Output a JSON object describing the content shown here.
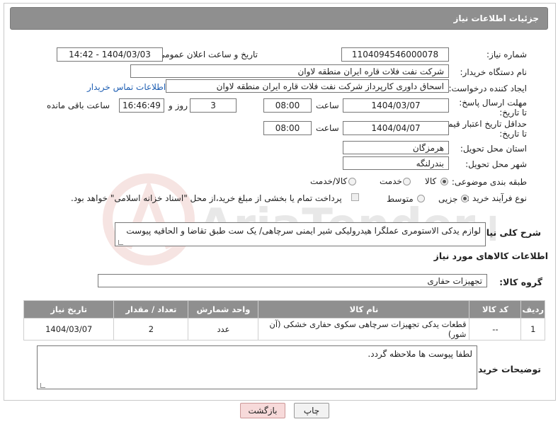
{
  "page_title": "جزئیات اطلاعات نیاز",
  "fields": {
    "need_number_label": "شماره نیاز:",
    "need_number": "1104094546000078",
    "announce_label": "تاریخ و ساعت اعلان عمومی:",
    "announce_value": "1404/03/03 - 14:42",
    "buyer_org_label": "نام دستگاه خریدار:",
    "buyer_org": "شرکت نفت فلات قاره ایران منطقه لاوان",
    "requester_label": "ایجاد کننده درخواست:",
    "requester": "اسحاق داوری کارپرداز شرکت نفت فلات قاره ایران منطقه لاوان",
    "buyer_contact_link": "اطلاعات تماس خریدار",
    "deadline_label": "مهلت ارسال پاسخ: تا تاریخ:",
    "deadline_date": "1404/03/07",
    "time_label": "ساعت",
    "deadline_time": "08:00",
    "days_value": "3",
    "days_label": "روز و",
    "remaining_time": "16:46:49",
    "remaining_label": "ساعت باقی مانده",
    "price_validity_label": "حداقل تاریخ اعتبار قیمت: تا تاریخ:",
    "price_validity_date": "1404/04/07",
    "price_validity_time": "08:00",
    "province_label": "استان محل تحویل:",
    "province": "هرمزگان",
    "city_label": "شهر محل تحویل:",
    "city": "بندرلنگه",
    "category_label": "طبقه بندی موضوعی:",
    "category_options": [
      "کالا",
      "خدمت",
      "کالا/خدمت"
    ],
    "process_label": "نوع فرآیند خرید :",
    "process_options": [
      "جزیی",
      "متوسط"
    ],
    "payment_note": "پرداخت تمام یا بخشی از مبلغ خرید،از محل \"اسناد خزانه اسلامی\" خواهد بود.",
    "description_label": "شرح کلی نیاز:",
    "description": "لوازم یدکی الاستومری عملگرا هیدرولیکی شیر ایمنی سرچاهی/ یک ست طبق تقاضا و الحاقیه پیوست"
  },
  "goods_section": {
    "title": "اطلاعات کالاهای مورد نیاز",
    "group_label": "گروه کالا:",
    "group_value": "تجهیزات حفاری",
    "headers": [
      "ردیف",
      "کد کالا",
      "نام کالا",
      "واحد شمارش",
      "تعداد / مقدار",
      "تاریخ نیاز"
    ],
    "rows": [
      {
        "row": "1",
        "code": "--",
        "name": "قطعات یدکی تجهیزات سرچاهی سکوی حفاری خشکی (آن شور)",
        "unit": "عدد",
        "qty": "2",
        "date": "1404/03/07"
      }
    ]
  },
  "buyer_notes_label": "توضیحات خریدار:",
  "buyer_notes": "لطفا پیوست ها ملاحظه گردد.",
  "buttons": {
    "print": "چاپ",
    "back": "بازگشت"
  },
  "watermark_text": "AriaTender.net"
}
